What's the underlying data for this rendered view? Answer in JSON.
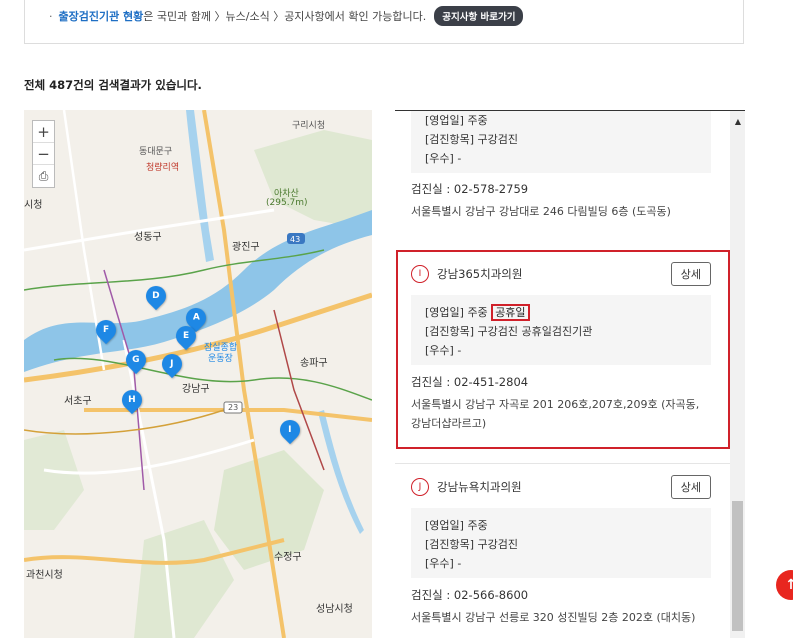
{
  "notice": {
    "bullet": "·",
    "link_text": "출장검진기관 현황",
    "rest_text": "은 국민과 함께 〉뉴스/소식 〉공지사항에서 확인 가능합니다.",
    "button_label": "공지사항 바로가기"
  },
  "result_count": "전체 487건의 검색결과가 있습니다.",
  "map": {
    "zoom_in": "+",
    "zoom_out": "−",
    "print": "⎙",
    "labels": {
      "gureu": "구리시청",
      "dongdaemun": "동대문구",
      "cheongnyangni": "청량리역",
      "achasan": "아차산",
      "achasan_h": "(295.7m)",
      "sicheong": "시청",
      "seongdong": "성동구",
      "gwangjin": "광진구",
      "gangnam": "강남구",
      "jamsil": "잠실종합",
      "jamsil2": "운동장",
      "songpa": "송파구",
      "seocho": "서초구",
      "sujeong": "수정구",
      "gwacheon": "과천시청",
      "seongnam": "성남시청",
      "road43": "43",
      "road23": "23"
    },
    "pins": [
      "D",
      "A",
      "F",
      "E",
      "G",
      "J",
      "H",
      "I"
    ]
  },
  "items": [
    {
      "partial": true,
      "hours": "[영업일] 주중",
      "checkups": "[검진항목] 구강검진",
      "excellent": "[우수] -",
      "phone": "검진실 : 02-578-2759",
      "address": "서울특별시 강남구 강남대로 246 다림빌딩 6층 (도곡동)"
    },
    {
      "badge": "I",
      "name": "강남365치과의원",
      "detail_label": "상세",
      "hours": "[영업일] 주중",
      "holiday": "공휴일",
      "checkups": "[검진항목] 구강검진 공휴일검진기관",
      "excellent": "[우수] -",
      "phone": "검진실 : 02-451-2804",
      "address": "서울특별시 강남구 자곡로 201 206호,207호,209호 (자곡동, 강남더샵라르고)"
    },
    {
      "badge": "J",
      "name": "강남뉴욕치과의원",
      "detail_label": "상세",
      "hours": "[영업일] 주중",
      "checkups": "[검진항목] 구강검진",
      "excellent": "[우수] -",
      "phone": "검진실 : 02-566-8600",
      "address": "서울특별시 강남구 선릉로 320 성진빌딩 2층 202호 (대치동)"
    }
  ],
  "scroll_up": "▲",
  "top_button": "↑",
  "colors": {
    "accent_red": "#d0212a",
    "link_blue": "#1f6fc4",
    "pin_blue": "#1e88e5",
    "river": "#8ec5e8"
  }
}
